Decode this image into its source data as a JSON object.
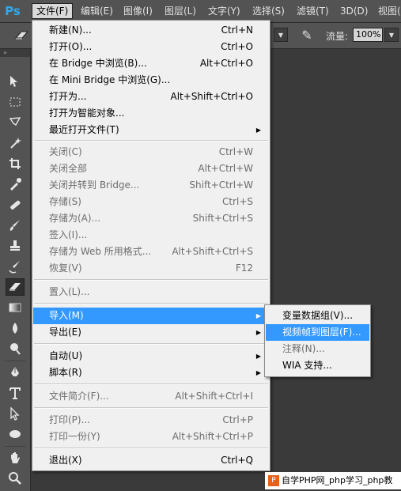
{
  "app": {
    "logo": "Ps"
  },
  "menubar": {
    "items": [
      "文件(F)",
      "编辑(E)",
      "图像(I)",
      "图层(L)",
      "文字(Y)",
      "选择(S)",
      "滤镜(T)",
      "3D(D)",
      "视图("
    ]
  },
  "options": {
    "flow_label": "流量:",
    "flow_value": "100%"
  },
  "file_menu": [
    {
      "label": "新建(N)...",
      "shortcut": "Ctrl+N"
    },
    {
      "label": "打开(O)...",
      "shortcut": "Ctrl+O"
    },
    {
      "label": "在 Bridge 中浏览(B)...",
      "shortcut": "Alt+Ctrl+O"
    },
    {
      "label": "在 Mini Bridge 中浏览(G)...",
      "shortcut": ""
    },
    {
      "label": "打开为...",
      "shortcut": "Alt+Shift+Ctrl+O"
    },
    {
      "label": "打开为智能对象...",
      "shortcut": ""
    },
    {
      "label": "最近打开文件(T)",
      "shortcut": ""
    },
    {
      "label": "关闭(C)",
      "shortcut": "Ctrl+W"
    },
    {
      "label": "关闭全部",
      "shortcut": "Alt+Ctrl+W"
    },
    {
      "label": "关闭并转到 Bridge...",
      "shortcut": "Shift+Ctrl+W"
    },
    {
      "label": "存储(S)",
      "shortcut": "Ctrl+S"
    },
    {
      "label": "存储为(A)...",
      "shortcut": "Shift+Ctrl+S"
    },
    {
      "label": "签入(I)...",
      "shortcut": ""
    },
    {
      "label": "存储为 Web 所用格式...",
      "shortcut": "Alt+Shift+Ctrl+S"
    },
    {
      "label": "恢复(V)",
      "shortcut": "F12"
    },
    {
      "label": "置入(L)...",
      "shortcut": ""
    },
    {
      "label": "导入(M)",
      "shortcut": ""
    },
    {
      "label": "导出(E)",
      "shortcut": ""
    },
    {
      "label": "自动(U)",
      "shortcut": ""
    },
    {
      "label": "脚本(R)",
      "shortcut": ""
    },
    {
      "label": "文件简介(F)...",
      "shortcut": "Alt+Shift+Ctrl+I"
    },
    {
      "label": "打印(P)...",
      "shortcut": "Ctrl+P"
    },
    {
      "label": "打印一份(Y)",
      "shortcut": "Alt+Shift+Ctrl+P"
    },
    {
      "label": "退出(X)",
      "shortcut": "Ctrl+Q"
    }
  ],
  "import_submenu": [
    {
      "label": "变量数据组(V)..."
    },
    {
      "label": "视频帧到图层(F)..."
    },
    {
      "label": "注释(N)..."
    },
    {
      "label": "WIA 支持..."
    }
  ],
  "watermark": {
    "text": "自学PHP网_php学习_php教",
    "logo": "P"
  },
  "colors": {
    "highlight": "#3399ff",
    "menu_bg": "#f0f0f0",
    "chrome": "#535353",
    "ps_blue": "#2fa8f0"
  }
}
